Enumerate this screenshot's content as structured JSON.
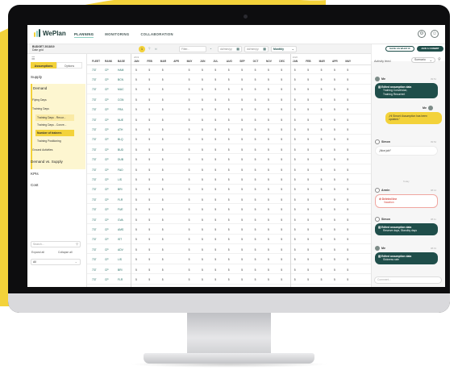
{
  "colors": {
    "brand_dark": "#1f4e4a",
    "brand_yellow": "#f3d23a",
    "accent_teal": "#8ed1c3",
    "alert_red": "#d5473f",
    "background_blob": "#f3d23a"
  },
  "app": {
    "name": "WePlan",
    "nav": [
      {
        "label": "PLANNING",
        "active": true
      },
      {
        "label": "MONITORING",
        "active": false
      },
      {
        "label": "COLLABORATION",
        "active": false
      }
    ],
    "icons": [
      "settings-icon",
      "user-icon"
    ]
  },
  "toolbar": {
    "budget_label": "BUDGET 2018/19",
    "budget_sub": "Date grid",
    "badge": "1",
    "mode_label": "tr/",
    "filter_placeholder": "Filter...",
    "date_from": "dd/mm/yy",
    "date_to": "dd/mm/yy",
    "period": "Monthly",
    "save_whatif": "SAVE AS WHAT IF",
    "add_commit": "ADD A COMMIT"
  },
  "left_panel": {
    "tabs": [
      {
        "label": "Assumptions",
        "active": true
      },
      {
        "label": "Options",
        "active": false
      }
    ],
    "sections": [
      "Supply",
      "Demand",
      "Demand vs. Supply",
      "KPIs",
      "Cost"
    ],
    "demand_items": [
      {
        "label": "Flying Days",
        "level": 1
      },
      {
        "label": "Training Days",
        "level": 1
      },
      {
        "label": "Training Days - Recur...",
        "level": 2
      },
      {
        "label": "Training Days - Conve...",
        "level": 2
      },
      {
        "label": "Number of trainers",
        "level": 2,
        "highlight": true
      },
      {
        "label": "Training Positioning",
        "level": 2
      },
      {
        "label": "Ground Activities",
        "level": 1
      }
    ],
    "search_placeholder": "Search...",
    "expand_all": "Expand all",
    "collapse_all": "Collapse all",
    "filter_value": "All"
  },
  "table": {
    "fixed_headers": [
      "FLEET",
      "RANK",
      "BASE"
    ],
    "years": [
      "2019",
      "2020"
    ],
    "months": [
      "JAN",
      "FEB",
      "MAR",
      "APR",
      "MAY",
      "JUN",
      "JUL",
      "AUG",
      "SEP",
      "OCT",
      "NOV",
      "DEC",
      "JAN",
      "FEB",
      "MAR",
      "APR",
      "MAY"
    ],
    "cell_value": "5",
    "rows": [
      {
        "fleet": "737",
        "rank": "CP",
        "base": "HAM"
      },
      {
        "fleet": "737",
        "rank": "CP",
        "base": "BCN"
      },
      {
        "fleet": "737",
        "rank": "CP",
        "base": "MUC"
      },
      {
        "fleet": "737",
        "rank": "CP",
        "base": "CGN"
      },
      {
        "fleet": "737",
        "rank": "CP",
        "base": "FRA"
      },
      {
        "fleet": "737",
        "rank": "CP",
        "base": "NUE"
      },
      {
        "fleet": "737",
        "rank": "CP",
        "base": "ATH"
      },
      {
        "fleet": "737",
        "rank": "CP",
        "base": "BLQ"
      },
      {
        "fleet": "737",
        "rank": "CP",
        "base": "BUD"
      },
      {
        "fleet": "737",
        "rank": "CP",
        "base": "DUB"
      },
      {
        "fleet": "737",
        "rank": "CP",
        "base": "FAO"
      },
      {
        "fleet": "737",
        "rank": "CP",
        "base": "LIS"
      },
      {
        "fleet": "737",
        "rank": "CP",
        "base": "BRI"
      },
      {
        "fleet": "737",
        "rank": "CP",
        "base": "FLR"
      },
      {
        "fleet": "737",
        "rank": "CP",
        "base": "FUE"
      },
      {
        "fleet": "737",
        "rank": "CP",
        "base": "GVA"
      },
      {
        "fleet": "737",
        "rank": "CP",
        "base": "AMS"
      },
      {
        "fleet": "737",
        "rank": "CP",
        "base": "IST"
      },
      {
        "fleet": "737",
        "rank": "CP",
        "base": "ADV"
      },
      {
        "fleet": "737",
        "rank": "CP",
        "base": "LIS"
      },
      {
        "fleet": "737",
        "rank": "CP",
        "base": "BRI"
      },
      {
        "fleet": "737",
        "rank": "CP",
        "base": "FLR"
      }
    ]
  },
  "feed": {
    "title": "Activity feed",
    "filter": "Scenario",
    "today": "Today",
    "comment_placeholder": "Comment...",
    "entries": [
      {
        "user": "Me",
        "time": "09:51",
        "type": "dark",
        "title": "Edited assumption data",
        "lines": [
          "Training Conversion,",
          "Training Recurrent"
        ]
      },
      {
        "user": "Me",
        "time": "",
        "type": "yellow",
        "title": "",
        "lines": [
          "„Hi Simon! Assumption has been",
          "updated.“"
        ]
      },
      {
        "user": "Simon",
        "time": "09:54",
        "type": "white",
        "title": "",
        "lines": [
          "„Nice job!“"
        ]
      },
      {
        "user": "Armin",
        "time": "08:14",
        "type": "red",
        "title": "Deleted line",
        "lines": [
          "Vacation"
        ]
      },
      {
        "user": "Simon",
        "time": "08:11",
        "type": "dark",
        "title": "Edited assumption data",
        "lines": [
          "Reserve days, Standby days"
        ]
      },
      {
        "user": "Me",
        "time": "08:01",
        "type": "dark",
        "title": "Edited assumption data",
        "lines": [
          "Sickness rate"
        ]
      }
    ]
  }
}
